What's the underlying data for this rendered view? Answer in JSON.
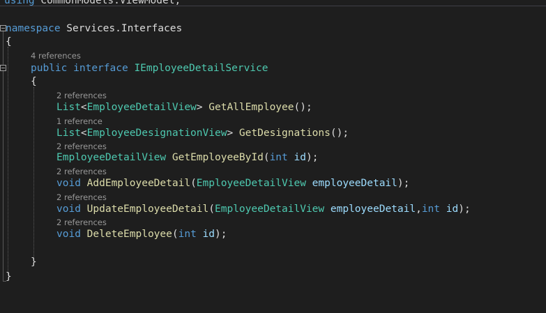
{
  "header": {
    "using_kw": "using",
    "using_ns": " CommonModels.ViewModel;"
  },
  "namespace": {
    "kw": "namespace",
    "name": " Services.Interfaces",
    "open": "{",
    "close": "}"
  },
  "interface": {
    "refs": "4 references",
    "kw_public": "public",
    "kw_interface": "interface",
    "name": "IEmployeeDetailService",
    "open": "{",
    "close": "}"
  },
  "members": [
    {
      "refs": "2 references",
      "tokens": [
        {
          "c": "ty",
          "t": "List"
        },
        {
          "c": "pl",
          "t": "<"
        },
        {
          "c": "ty",
          "t": "EmployeeDetailView"
        },
        {
          "c": "pl",
          "t": "> "
        },
        {
          "c": "fn",
          "t": "GetAllEmployee"
        },
        {
          "c": "pl",
          "t": "();"
        }
      ]
    },
    {
      "refs": "1 reference",
      "tokens": [
        {
          "c": "ty",
          "t": "List"
        },
        {
          "c": "pl",
          "t": "<"
        },
        {
          "c": "ty",
          "t": "EmployeeDesignationView"
        },
        {
          "c": "pl",
          "t": "> "
        },
        {
          "c": "fn",
          "t": "GetDesignations"
        },
        {
          "c": "pl",
          "t": "();"
        }
      ]
    },
    {
      "refs": "2 references",
      "tokens": [
        {
          "c": "ty",
          "t": "EmployeeDetailView"
        },
        {
          "c": "pl",
          "t": " "
        },
        {
          "c": "fn",
          "t": "GetEmployeeById"
        },
        {
          "c": "pl",
          "t": "("
        },
        {
          "c": "kw",
          "t": "int"
        },
        {
          "c": "pl",
          "t": " "
        },
        {
          "c": "pa",
          "t": "id"
        },
        {
          "c": "pl",
          "t": ");"
        }
      ]
    },
    {
      "refs": "2 references",
      "tokens": [
        {
          "c": "kw",
          "t": "void"
        },
        {
          "c": "pl",
          "t": " "
        },
        {
          "c": "fn",
          "t": "AddEmployeeDetail"
        },
        {
          "c": "pl",
          "t": "("
        },
        {
          "c": "ty",
          "t": "EmployeeDetailView"
        },
        {
          "c": "pl",
          "t": " "
        },
        {
          "c": "pa",
          "t": "employeeDetail"
        },
        {
          "c": "pl",
          "t": ");"
        }
      ]
    },
    {
      "refs": "2 references",
      "tokens": [
        {
          "c": "kw",
          "t": "void"
        },
        {
          "c": "pl",
          "t": " "
        },
        {
          "c": "fn",
          "t": "UpdateEmployeeDetail"
        },
        {
          "c": "pl",
          "t": "("
        },
        {
          "c": "ty",
          "t": "EmployeeDetailView"
        },
        {
          "c": "pl",
          "t": " "
        },
        {
          "c": "pa",
          "t": "employeeDetail"
        },
        {
          "c": "pl",
          "t": ","
        },
        {
          "c": "kw",
          "t": "int"
        },
        {
          "c": "pl",
          "t": " "
        },
        {
          "c": "pa",
          "t": "id"
        },
        {
          "c": "pl",
          "t": ");"
        }
      ]
    },
    {
      "refs": "2 references",
      "tokens": [
        {
          "c": "kw",
          "t": "void"
        },
        {
          "c": "pl",
          "t": " "
        },
        {
          "c": "fn",
          "t": "DeleteEmployee"
        },
        {
          "c": "pl",
          "t": "("
        },
        {
          "c": "kw",
          "t": "int"
        },
        {
          "c": "pl",
          "t": " "
        },
        {
          "c": "pa",
          "t": "id"
        },
        {
          "c": "pl",
          "t": ");"
        }
      ]
    }
  ],
  "colors": {
    "background": "#1e1e1e",
    "keyword": "#569cd6",
    "type": "#4ec9b0",
    "method": "#dcdcaa",
    "parameter": "#9cdcfe",
    "plain": "#dcdcdc",
    "codelens": "#999999"
  }
}
